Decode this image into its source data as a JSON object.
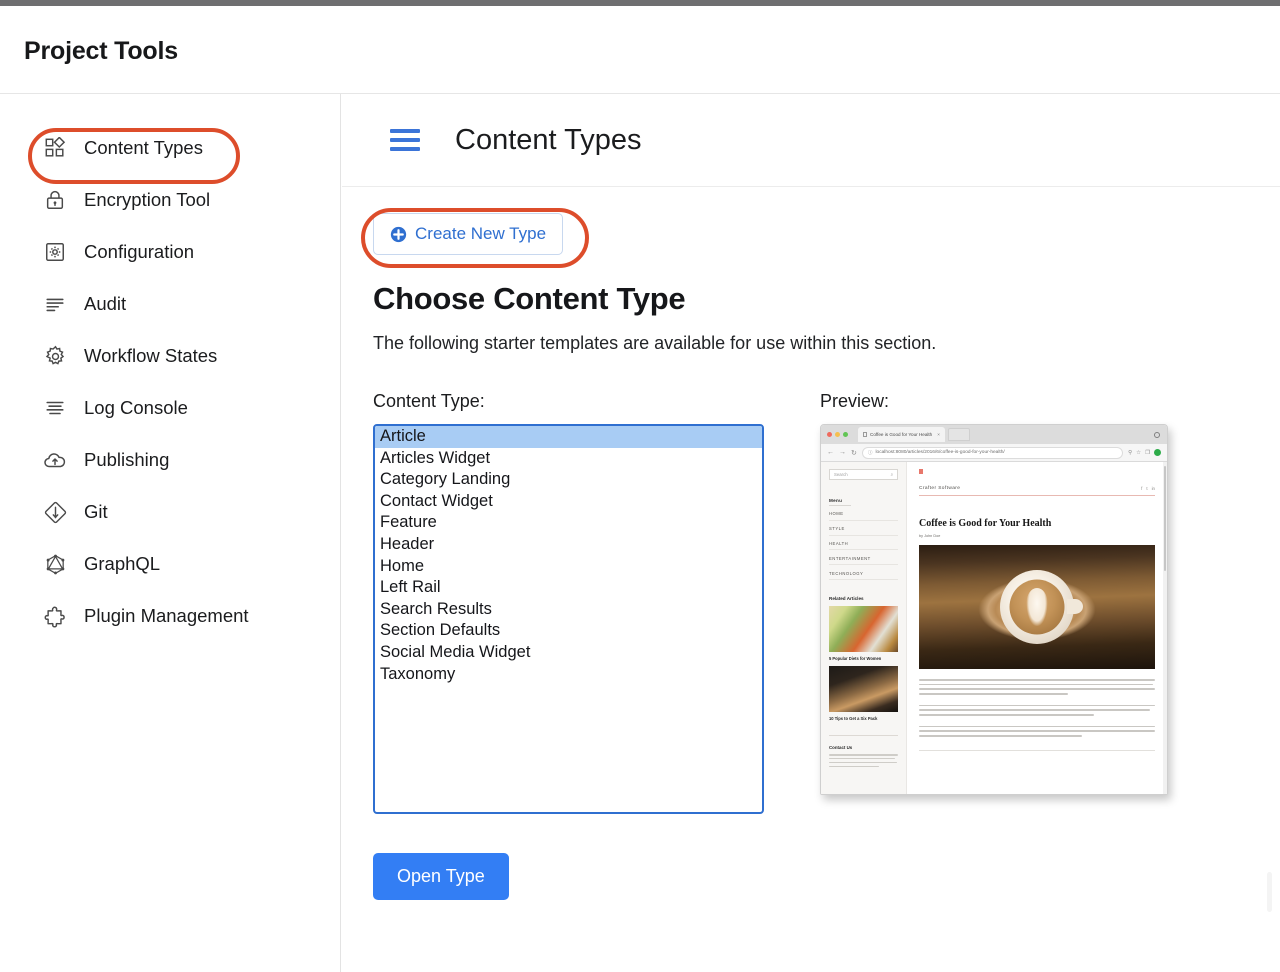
{
  "window": {
    "app_title": "Project Tools"
  },
  "sidebar": {
    "items": [
      {
        "label": "Content Types",
        "icon": "grid-shapes-icon",
        "active": true
      },
      {
        "label": "Encryption Tool",
        "icon": "lock-icon",
        "active": false
      },
      {
        "label": "Configuration",
        "icon": "gear-square-icon",
        "active": false
      },
      {
        "label": "Audit",
        "icon": "lines-left-icon",
        "active": false
      },
      {
        "label": "Workflow States",
        "icon": "gear-icon",
        "active": false
      },
      {
        "label": "Log Console",
        "icon": "lines-center-icon",
        "active": false
      },
      {
        "label": "Publishing",
        "icon": "cloud-upload-icon",
        "active": false
      },
      {
        "label": "Git",
        "icon": "git-diamond-icon",
        "active": false
      },
      {
        "label": "GraphQL",
        "icon": "graphql-hexagon-icon",
        "active": false
      },
      {
        "label": "Plugin Management",
        "icon": "puzzle-piece-icon",
        "active": false
      }
    ]
  },
  "main": {
    "header_title": "Content Types",
    "menu_icon": "hamburger-icon",
    "create_button": {
      "label": "Create New Type",
      "icon": "plus-circle-icon"
    },
    "section_title": "Choose Content Type",
    "section_desc": "The following starter templates are available for use within this section.",
    "content_type_label": "Content Type:",
    "preview_label": "Preview:",
    "content_types": [
      "Article",
      "Articles Widget",
      "Category Landing",
      "Contact Widget",
      "Feature",
      "Header",
      "Home",
      "Left Rail",
      "Search Results",
      "Section Defaults",
      "Social Media Widget",
      "Taxonomy"
    ],
    "selected_content_type": "Article",
    "open_button_label": "Open Type"
  },
  "preview": {
    "browser": {
      "tab_title": "Coffee is Good for Your Health",
      "tab_close": "×",
      "url": "localhost:8080/articles/2016/6/coffee-is-good-for-your-health/",
      "back": "←",
      "forward": "→",
      "reload": "↻",
      "lock": "ⓘ",
      "search_icon": "⚲",
      "star_icon": "☆",
      "window_icon": "❐"
    },
    "site": {
      "search_placeholder": "Search",
      "menu_heading": "Menu",
      "menu_items": [
        "HOME",
        "STYLE",
        "HEALTH",
        "ENTERTAINMENT",
        "TECHNOLOGY"
      ],
      "related_heading": "Related Articles",
      "related_items": [
        "5 Popular Diets for Women",
        "10 Tips to Get a Six Pack"
      ],
      "contact_heading": "Contact Us",
      "brand": "Crafter Software",
      "article_title": "Coffee is Good for Your Health",
      "article_byline": "by John Doe"
    }
  },
  "annotations": {
    "ring_color": "#dd4d2b",
    "targets": [
      "sidebar-item-content-types",
      "create-new-type-button"
    ]
  },
  "colors": {
    "accent_blue": "#337ef4",
    "link_blue": "#2f6fd0",
    "selection_blue": "#a8ccf4",
    "annotation_red": "#dd4d2b",
    "title_bar_gray": "#6e6e70"
  }
}
